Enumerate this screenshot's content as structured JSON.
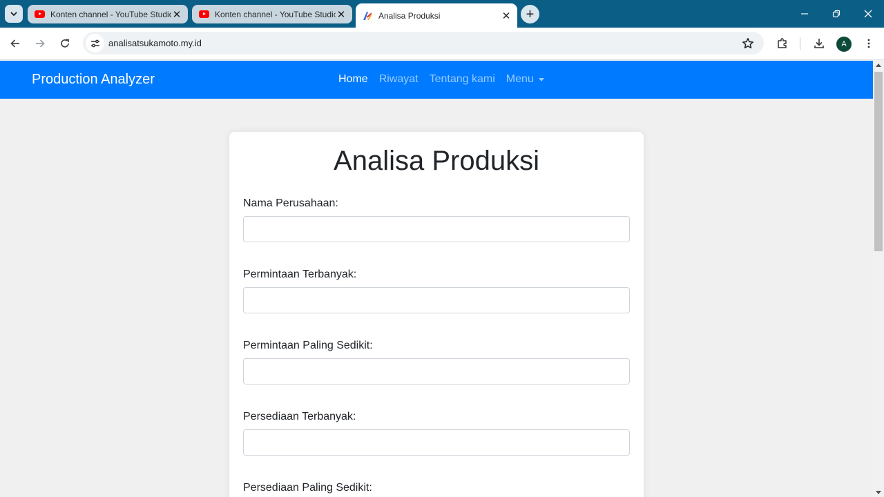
{
  "browser": {
    "tabs": [
      {
        "title": "Konten channel - YouTube Studio",
        "favicon": "youtube-icon",
        "active": false
      },
      {
        "title": "Konten channel - YouTube Studio",
        "favicon": "youtube-icon",
        "active": false
      },
      {
        "title": "Analisa Produksi",
        "favicon": "site-logo-icon",
        "active": true
      }
    ],
    "url": "analisatsukamoto.my.id",
    "profile_initial": "A",
    "colors": {
      "tabstrip": "#0b5e86",
      "youtube_red": "#ff0000",
      "avatar": "#0d4a3a"
    }
  },
  "navbar": {
    "brand": "Production Analyzer",
    "links": [
      {
        "label": "Home",
        "active": true
      },
      {
        "label": "Riwayat",
        "active": false
      },
      {
        "label": "Tentang kami",
        "active": false
      },
      {
        "label": "Menu",
        "active": false,
        "dropdown": true
      }
    ],
    "color": "#007bff"
  },
  "form": {
    "title": "Analisa Produksi",
    "fields": [
      {
        "label": "Nama Perusahaan:",
        "value": ""
      },
      {
        "label": "Permintaan Terbanyak:",
        "value": ""
      },
      {
        "label": "Permintaan Paling Sedikit:",
        "value": ""
      },
      {
        "label": "Persediaan Terbanyak:",
        "value": ""
      },
      {
        "label": "Persediaan Paling Sedikit:",
        "value": ""
      }
    ]
  }
}
